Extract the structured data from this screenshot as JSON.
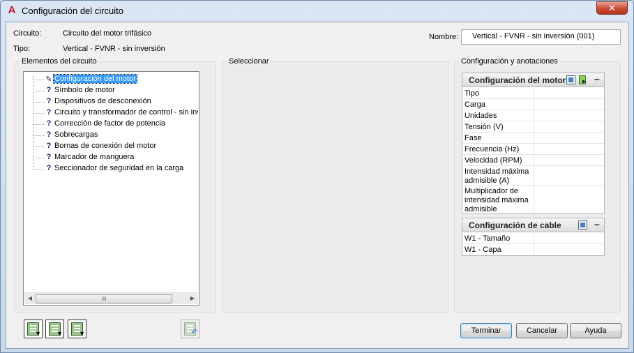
{
  "window": {
    "title": "Configuración del circuito"
  },
  "header": {
    "circuit_label": "Circuito:",
    "circuit_value": "Circuito del motor trifásico",
    "type_label": "Tipo:",
    "type_value": "Vertical - FVNR - sin inversión",
    "name_label": "Nombre:",
    "name_value": "Vertical - FVNR - sin inversión (001)"
  },
  "elements_group": {
    "title": "Elementos del circuito",
    "items": [
      {
        "icon": "pencil-icon",
        "label": "Configuración del motor",
        "selected": true
      },
      {
        "icon": "question-icon",
        "label": "Símbolo de motor"
      },
      {
        "icon": "question-icon",
        "label": "Dispositivos de desconexión"
      },
      {
        "icon": "question-icon",
        "label": "Circuito y transformador de control - sin inver"
      },
      {
        "icon": "question-icon",
        "label": "Corrección de factor de potencia"
      },
      {
        "icon": "question-icon",
        "label": "Sobrecargas"
      },
      {
        "icon": "question-icon",
        "label": "Bornas de conexión del motor"
      },
      {
        "icon": "question-icon",
        "label": "Marcador de manguera"
      },
      {
        "icon": "question-icon",
        "label": "Seccionador de seguridad en la carga"
      }
    ],
    "scroll_thumb": "III"
  },
  "select_group": {
    "title": "Seleccionar"
  },
  "config_group": {
    "title": "Configuración y anotaciones",
    "motor_panel": {
      "title": "Configuración del motor",
      "rows": [
        {
          "label": "Tipo",
          "value": ""
        },
        {
          "label": "Carga",
          "value": ""
        },
        {
          "label": "Unidades",
          "value": ""
        },
        {
          "label": "Tensión (V)",
          "value": ""
        },
        {
          "label": "Fase",
          "value": ""
        },
        {
          "label": "Frecuencia (Hz)",
          "value": ""
        },
        {
          "label": "Velocidad (RPM)",
          "value": ""
        },
        {
          "label": "Intensidad máxima admisible (A)",
          "value": ""
        },
        {
          "label": "Multiplicador de intensidad máxima admisible",
          "value": ""
        }
      ]
    },
    "cable_panel": {
      "title": "Configuración de cable",
      "rows": [
        {
          "label": "W1 - Tamaño",
          "value": ""
        },
        {
          "label": "W1 - Capa",
          "value": ""
        }
      ]
    }
  },
  "buttons": {
    "finish": "Terminar",
    "cancel": "Cancelar",
    "help": "Ayuda",
    "close_glyph": "✕",
    "minimize_glyph": "–"
  },
  "colors": {
    "selection": "#3399ff",
    "close_button": "#c94a33",
    "app_icon": "#c8102e"
  }
}
